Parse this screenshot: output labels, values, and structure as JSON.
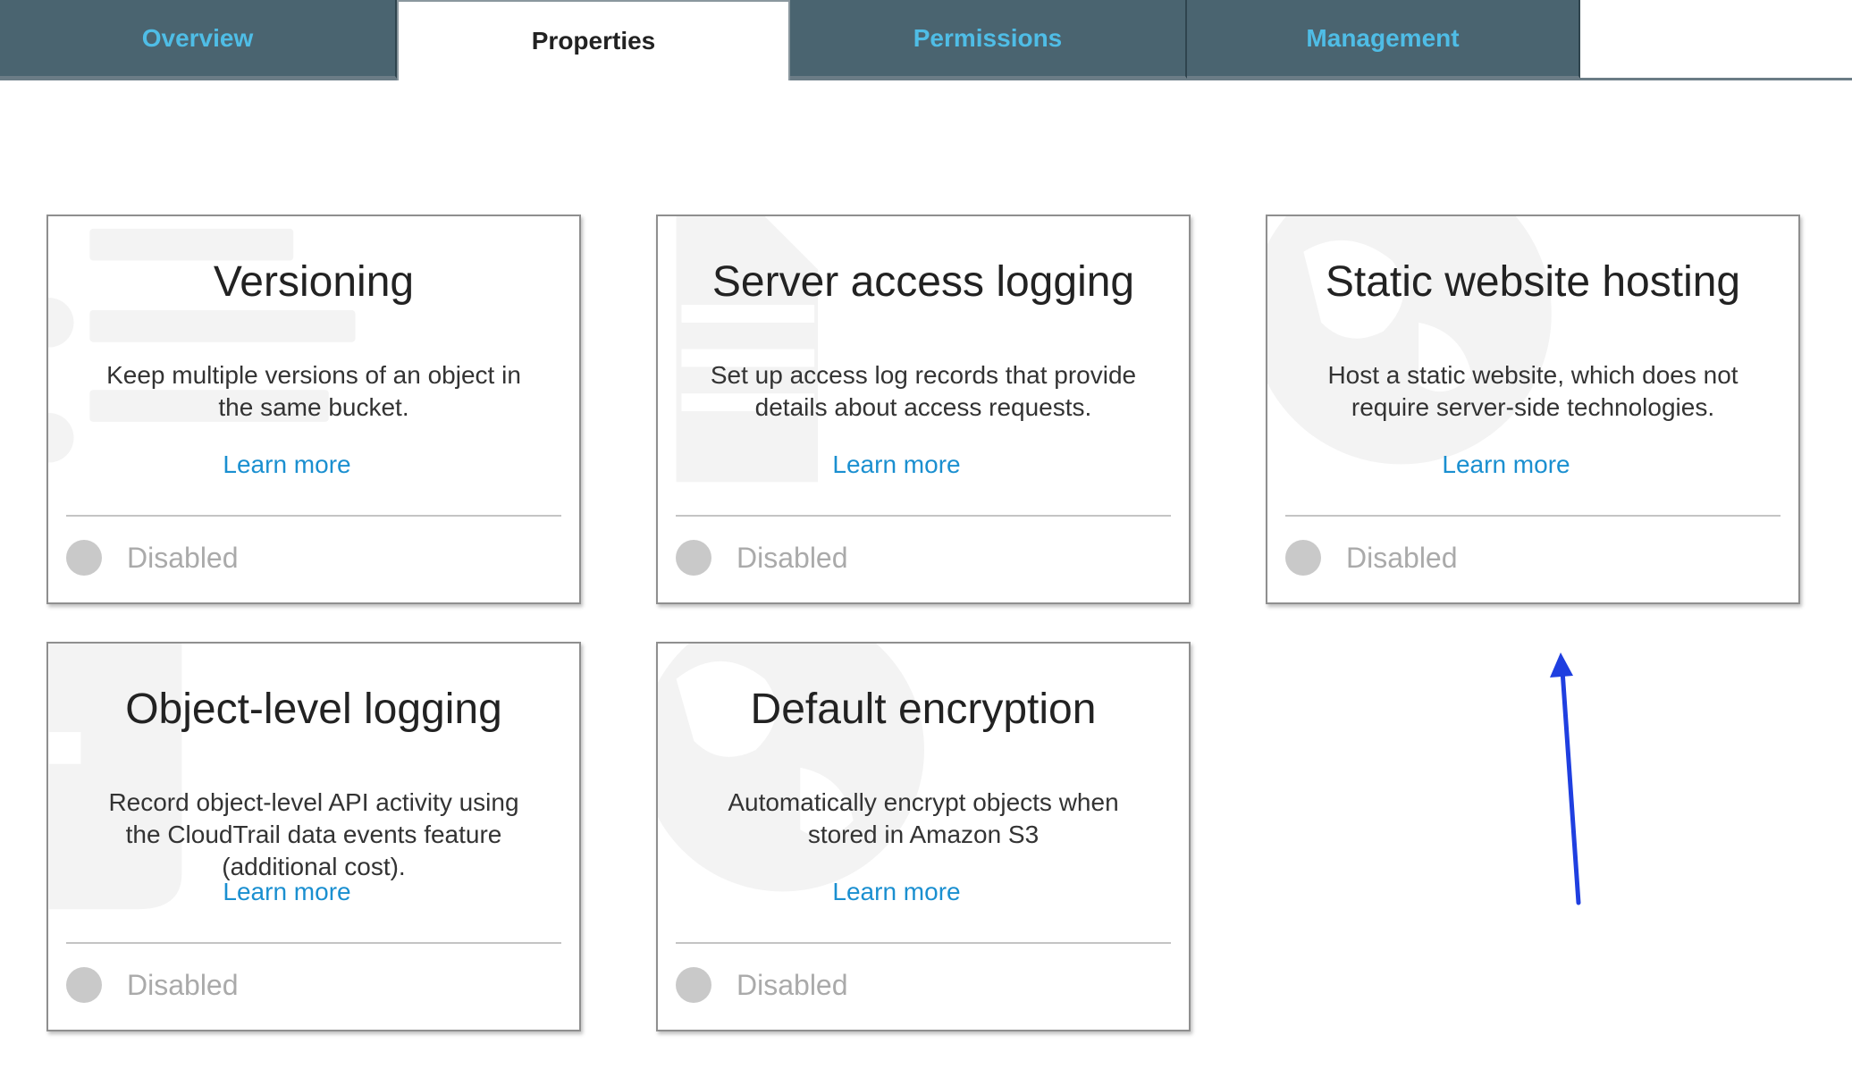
{
  "tabs": [
    {
      "label": "Overview",
      "active": false
    },
    {
      "label": "Properties",
      "active": true
    },
    {
      "label": "Permissions",
      "active": false
    },
    {
      "label": "Management",
      "active": false
    }
  ],
  "cards": [
    {
      "title": "Versioning",
      "description": "Keep multiple versions of an object in the same bucket.",
      "link": "Learn more",
      "status": "Disabled"
    },
    {
      "title": "Server access logging",
      "description": "Set up access log records that provide details about access requests.",
      "link": "Learn more",
      "status": "Disabled"
    },
    {
      "title": "Static website hosting",
      "description": "Host a static website, which does not require server-side technologies.",
      "link": "Learn more",
      "status": "Disabled"
    },
    {
      "title": "Object-level logging",
      "description": "Record object-level API activity using the CloudTrail data events feature (additional cost).",
      "link": "Learn more",
      "status": "Disabled"
    },
    {
      "title": "Default encryption",
      "description": "Automatically encrypt objects when stored in Amazon S3",
      "link": "Learn more",
      "status": "Disabled"
    }
  ],
  "icons": {
    "watermark_versioning": "versioning-list-icon",
    "watermark_logging": "log-file-icon",
    "watermark_hosting": "globe-icon",
    "watermark_object_logging": "shield-icon",
    "watermark_encryption": "globe-icon",
    "annotation": "arrow-up-icon"
  },
  "colors": {
    "tab_inactive_bg": "#4a6470",
    "tab_inactive_text": "#4fbde6",
    "link": "#1a8fd0",
    "status_disabled": "#aaaaaa",
    "annotation_arrow": "#1f3fe0"
  }
}
